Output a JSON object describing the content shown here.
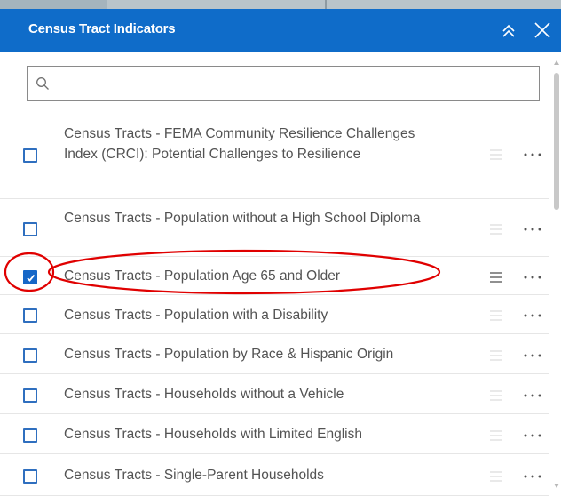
{
  "panel": {
    "title": "Census Tract Indicators",
    "collapse_icon": "double-chevron-up-icon",
    "close_icon": "close-icon"
  },
  "search": {
    "icon": "search-icon",
    "value": "",
    "placeholder": ""
  },
  "layers": [
    {
      "label": "Census Tracts - FEMA Community Resilience Challenges Index (CRCI): Potential Challenges to Resilience",
      "checked": false
    },
    {
      "label": "Census Tracts - Population without a High School Diploma",
      "checked": false
    },
    {
      "label": "Census Tracts - Population Age 65 and Older",
      "checked": true
    },
    {
      "label": "Census Tracts - Population with a Disability",
      "checked": false
    },
    {
      "label": "Census Tracts - Population by Race & Hispanic Origin",
      "checked": false
    },
    {
      "label": "Census Tracts - Households without a Vehicle",
      "checked": false
    },
    {
      "label": "Census Tracts - Households with Limited English",
      "checked": false
    },
    {
      "label": "Census Tracts - Single-Parent Households",
      "checked": false
    }
  ],
  "colors": {
    "header_bg": "#0f6cc9",
    "checkbox_border": "#2f6fbf",
    "checkbox_checked": "#1667c7",
    "annotation": "#e00000"
  }
}
